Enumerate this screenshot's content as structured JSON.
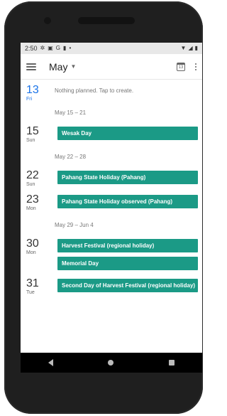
{
  "status_bar": {
    "time": "2:50",
    "left_icons": [
      "settings-icon",
      "photo-icon",
      "google-icon",
      "sd-card-icon",
      "dot-icon"
    ],
    "right_icons": [
      "wifi-icon",
      "signal-icon",
      "battery-icon"
    ]
  },
  "app_bar": {
    "month": "May",
    "menu_icon": "hamburger-menu-icon",
    "today_icon_label": "13",
    "overflow_icon": "more-vert-icon"
  },
  "today": {
    "day": "13",
    "weekday": "Fri",
    "message": "Nothing planned. Tap to create."
  },
  "weeks": [
    {
      "label": "May 15 – 21",
      "days": [
        {
          "day": "15",
          "weekday": "Sun",
          "events": [
            "Wesak Day"
          ]
        }
      ]
    },
    {
      "label": "May 22 – 28",
      "days": [
        {
          "day": "22",
          "weekday": "Sun",
          "events": [
            "Pahang State Holiday (Pahang)"
          ]
        },
        {
          "day": "23",
          "weekday": "Mon",
          "events": [
            "Pahang State Holiday observed (Pahang)"
          ]
        }
      ]
    },
    {
      "label": "May 29 – Jun 4",
      "days": [
        {
          "day": "30",
          "weekday": "Mon",
          "events": [
            "Harvest Festival (regional holiday)",
            "Memorial Day"
          ]
        },
        {
          "day": "31",
          "weekday": "Tue",
          "events": [
            "Second Day of Harvest Festival (regional holiday)"
          ]
        }
      ]
    }
  ],
  "fab": {
    "label": "+"
  },
  "colors": {
    "event": "#1b9a86",
    "today": "#1a73e8",
    "fab": "#e53935"
  }
}
